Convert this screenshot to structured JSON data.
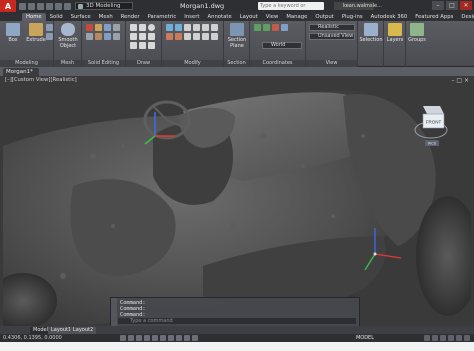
{
  "titlebar": {
    "app_letter": "A",
    "workspace": "3D Modeling",
    "document": "Morgan1.dwg",
    "search_placeholder": "Type a keyword or phrase",
    "user": "kean.walmsle...",
    "controls": [
      "–",
      "□",
      "✕"
    ]
  },
  "ribbon_tabs": [
    "Home",
    "Solid",
    "Surface",
    "Mesh",
    "Render",
    "Parametric",
    "Insert",
    "Annotate",
    "Layout",
    "View",
    "Manage",
    "Output",
    "Plug-ins",
    "Autodesk 360",
    "Featured Apps",
    "DesignScript"
  ],
  "ribbon": {
    "panels": [
      "Modeling",
      "Mesh",
      "Solid Editing",
      "Draw",
      "Modify",
      "Section",
      "Coordinates",
      "View"
    ],
    "buttons": {
      "box": "Box",
      "extrude": "Extrude",
      "smooth": "Smooth\nObject",
      "section_plane": "Section\nPlane",
      "selection": "Selection",
      "layers": "Layers",
      "groups": "Groups"
    },
    "visual_style": "Realistic",
    "view_state": "Unsaved View",
    "ucs": "World"
  },
  "file_tab": "Morgan1*",
  "viewport": {
    "label": "[–][Custom View][Realistic]",
    "controls": "– □ ×",
    "viewcube_face": "FRONT",
    "viewcube_compass": "WCS"
  },
  "command": {
    "lines": [
      "Command:",
      "Command:",
      "Command:"
    ],
    "prompt": "Type a command"
  },
  "layouts": [
    "Model",
    "Layout1",
    "Layout2"
  ],
  "status": {
    "coords": "0.4306, 0.1395, 0.0000",
    "model": "MODEL"
  },
  "colors": {
    "accent_red": "#c8281e",
    "axis_x": "#e03a2f",
    "axis_y": "#3bbf4a",
    "axis_z": "#3a6cf0"
  }
}
